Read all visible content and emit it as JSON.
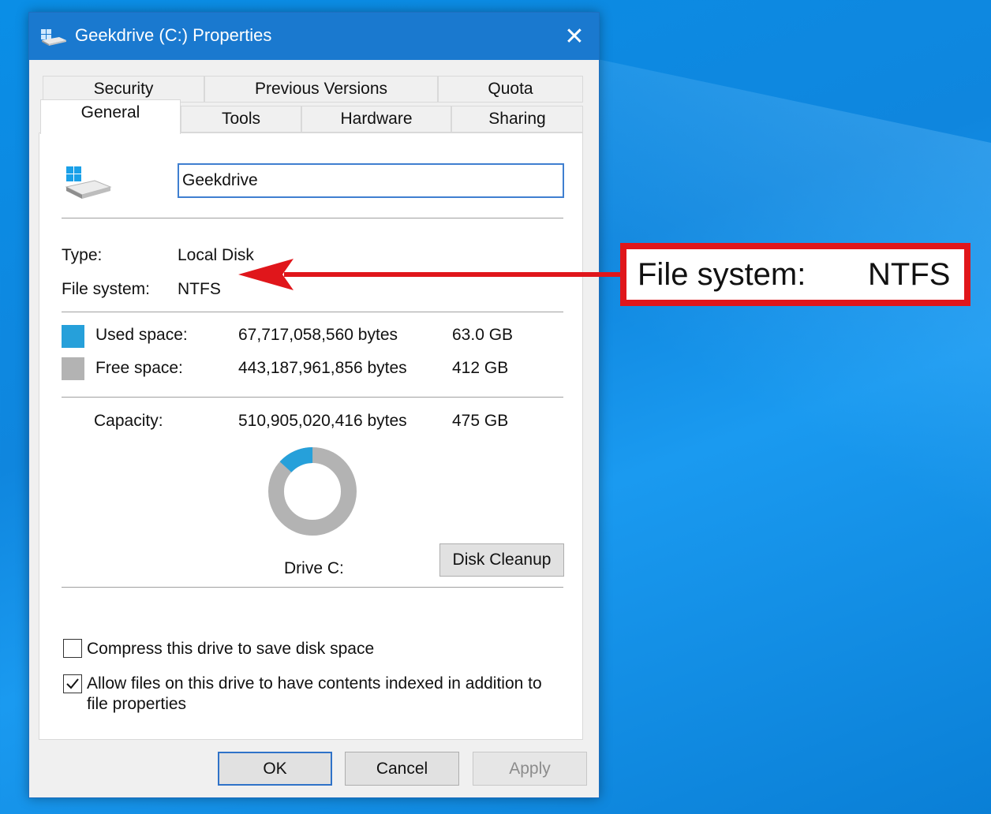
{
  "window": {
    "title": "Geekdrive (C:) Properties"
  },
  "tabs": {
    "row_back": [
      "Security",
      "Previous Versions",
      "Quota"
    ],
    "row_front": [
      "General",
      "Tools",
      "Hardware",
      "Sharing"
    ],
    "active": "General"
  },
  "general": {
    "drive_name": "Geekdrive",
    "type_label": "Type:",
    "type_value": "Local Disk",
    "fs_label": "File system:",
    "fs_value": "NTFS",
    "used_label": "Used space:",
    "used_bytes": "67,717,058,560 bytes",
    "used_gb": "63.0 GB",
    "free_label": "Free space:",
    "free_bytes": "443,187,961,856 bytes",
    "free_gb": "412 GB",
    "capacity_label": "Capacity:",
    "capacity_bytes": "510,905,020,416 bytes",
    "capacity_gb": "475 GB",
    "drive_label": "Drive C:",
    "disk_cleanup_label": "Disk Cleanup",
    "compress_label": "Compress this drive to save disk space",
    "compress_checked": false,
    "index_label_line1": "Allow files on this drive to have contents indexed in addition to",
    "index_label_line2": "file properties",
    "index_checked": true,
    "used_fraction": 0.1325
  },
  "buttons": {
    "ok": "OK",
    "cancel": "Cancel",
    "apply": "Apply"
  },
  "callout": {
    "label": "File system:",
    "value": "NTFS"
  },
  "colors": {
    "used": "#26a0da",
    "free": "#b3b3b3",
    "titlebar": "#1a79cf",
    "callout_border": "#e0161b",
    "arrow": "#e0161b"
  },
  "icons": [
    "drive-icon",
    "close-icon",
    "checkbox-icon",
    "arrow-icon"
  ]
}
